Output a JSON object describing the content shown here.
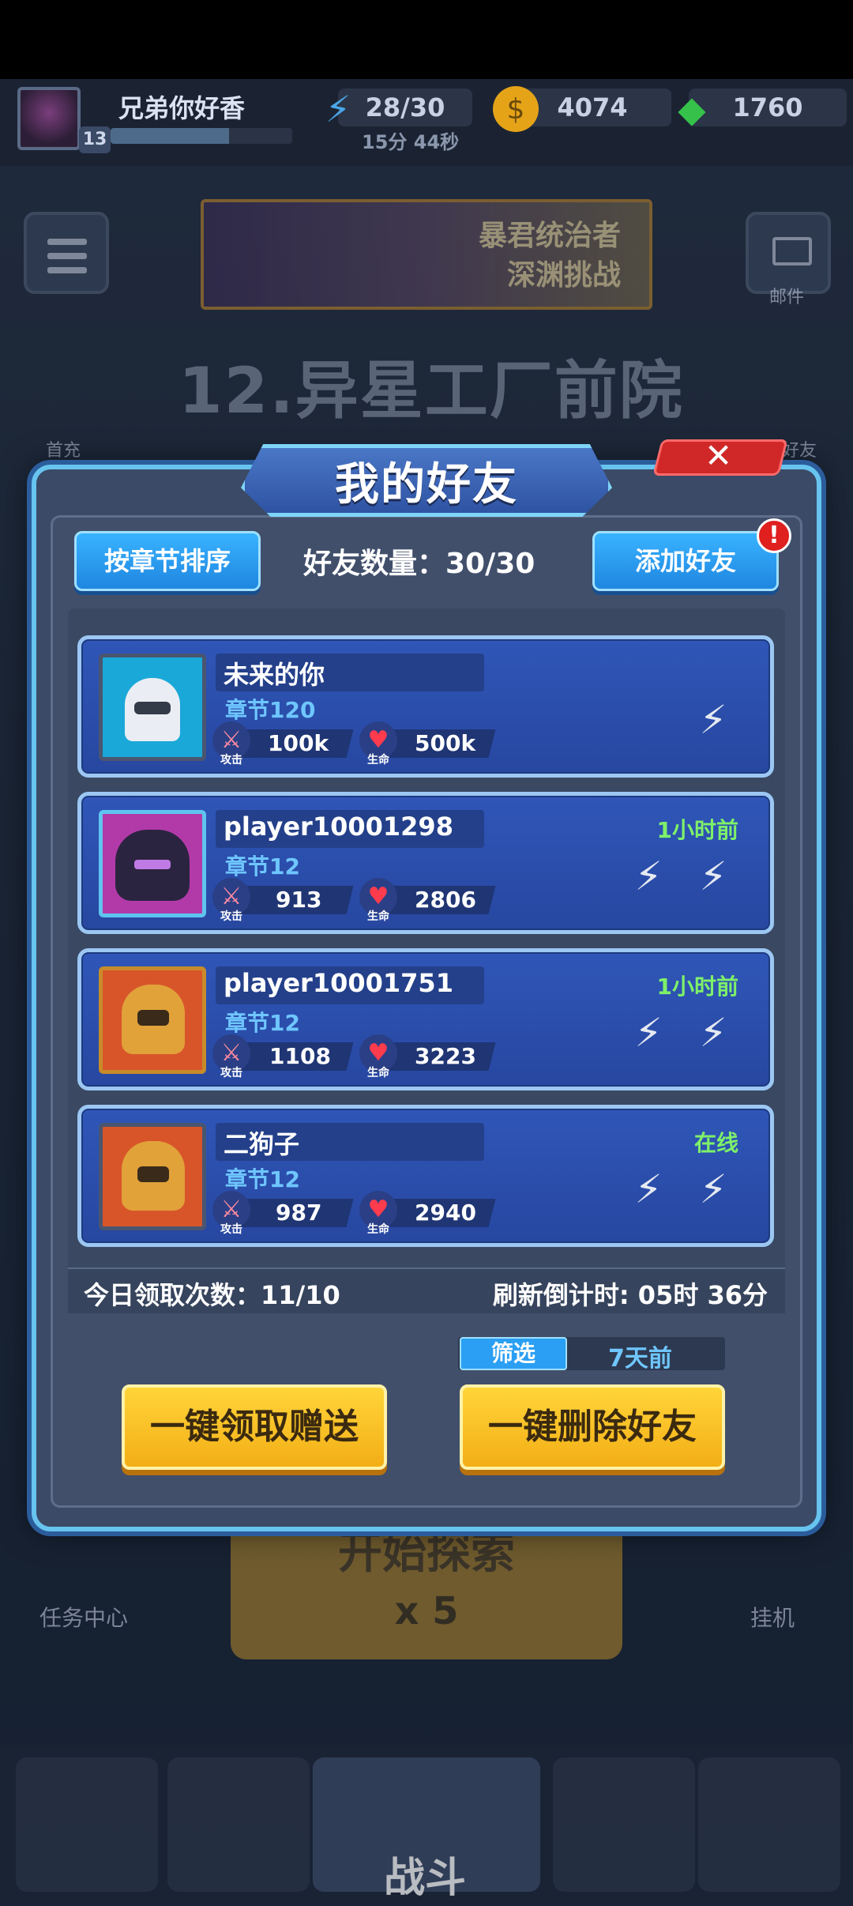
{
  "top_bar": {
    "player_name": "兄弟你好香",
    "level": "13",
    "xp_fraction": 0.65,
    "energy": "28/30",
    "energy_timer": "15分 44秒",
    "gold": "4074",
    "gems": "1760"
  },
  "scene": {
    "banner_line1": "暴君统治者",
    "banner_line2": "深渊挑战",
    "mail_label": "邮件",
    "stage_title": "12.异星工厂前院",
    "first_charge_label": "首充",
    "my_friends_label": "我的好友",
    "task_center_label": "任务中心",
    "idle_label": "挂机",
    "start_label": "开始探索",
    "start_cost": "x 5",
    "battle_label": "战斗"
  },
  "modal": {
    "title": "我的好友",
    "close_glyph": "✕",
    "sort_button": "按章节排序",
    "friend_count_label": "好友数量：30/30",
    "add_button": "添加好友",
    "alert_glyph": "!",
    "attack_caption": "攻击",
    "hp_caption": "生命",
    "friends": [
      {
        "name": "未来的你",
        "chapter": "章节120",
        "attack": "100k",
        "hp": "500k",
        "status": "",
        "avatar_color": "#1aa8d8"
      },
      {
        "name": "player10001298",
        "chapter": "章节12",
        "attack": "913",
        "hp": "2806",
        "status": "1小时前",
        "avatar_color": "#b23aa8"
      },
      {
        "name": "player10001751",
        "chapter": "章节12",
        "attack": "1108",
        "hp": "3223",
        "status": "1小时前",
        "avatar_color": "#d8552a"
      },
      {
        "name": "二狗子",
        "chapter": "章节12",
        "attack": "987",
        "hp": "2940",
        "status": "在线",
        "avatar_color": "#d8552a"
      }
    ],
    "claims_today": "今日领取次数：11/10",
    "refresh_countdown": "刷新倒计时: 05时 36分",
    "filter_label": "筛选",
    "filter_value": "7天前",
    "claim_all_button": "一键领取赠送",
    "delete_all_button": "一键删除好友"
  },
  "colors": {
    "accent_blue": "#2b9ff3",
    "accent_yellow": "#ffd53a",
    "online_green": "#7ef06a",
    "chapter_blue": "#6fc6ff"
  }
}
